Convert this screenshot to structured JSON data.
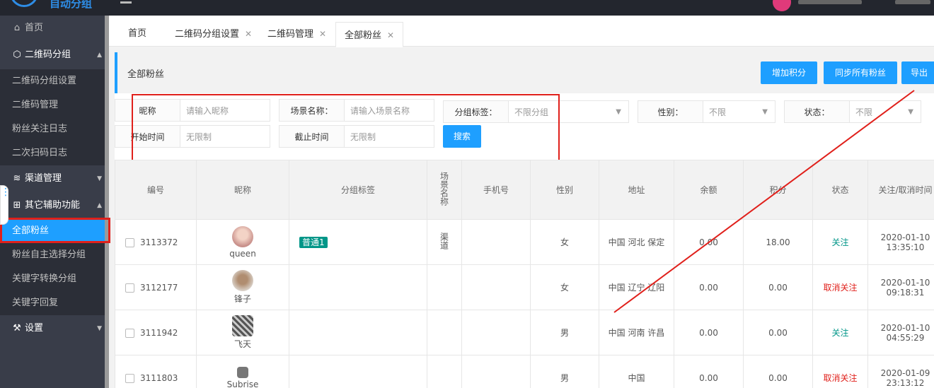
{
  "app": {
    "logo_text": "自动分组"
  },
  "sidebar": {
    "items": [
      {
        "label": "首页",
        "icon": "home-icon"
      },
      {
        "label": "二维码分组",
        "icon": "cube-icon"
      },
      {
        "label": "二维码分组设置"
      },
      {
        "label": "二维码管理"
      },
      {
        "label": "粉丝关注日志"
      },
      {
        "label": "二次扫码日志"
      },
      {
        "label": "渠道管理",
        "icon": "layers-icon"
      },
      {
        "label": "其它辅助功能",
        "icon": "apps-icon"
      },
      {
        "label": "全部粉丝"
      },
      {
        "label": "粉丝自主选择分组"
      },
      {
        "label": "关键字转换分组"
      },
      {
        "label": "关键字回复"
      },
      {
        "label": "设置",
        "icon": "wrench-icon"
      }
    ]
  },
  "tabs": [
    {
      "label": "首页",
      "closable": false
    },
    {
      "label": "二维码分组设置",
      "closable": true
    },
    {
      "label": "二维码管理",
      "closable": true
    },
    {
      "label": "全部粉丝",
      "closable": true,
      "active": true
    }
  ],
  "header": {
    "title": "全部粉丝",
    "buttons": {
      "add_points": "增加积分",
      "sync_fans": "同步所有粉丝",
      "export": "导出"
    }
  },
  "filters": {
    "nickname": {
      "label": "昵称",
      "placeholder": "请输入昵称"
    },
    "scene": {
      "label": "场景名称：",
      "placeholder": "请输入场景名称"
    },
    "group_tag": {
      "label": "分组标签：",
      "value": "不限分组"
    },
    "gender": {
      "label": "性别：",
      "value": "不限"
    },
    "status": {
      "label": "状态：",
      "value": "不限"
    },
    "start_time": {
      "label": "开始时间",
      "placeholder": "无限制"
    },
    "end_time": {
      "label": "截止时间",
      "placeholder": "无限制"
    },
    "search_label": "搜索"
  },
  "table": {
    "columns": [
      "编号",
      "昵称",
      "分组标签",
      "场景名称",
      "手机号",
      "性别",
      "地址",
      "余额",
      "积分",
      "状态",
      "关注/取消时间"
    ],
    "rows": [
      {
        "id": "3113372",
        "nickname": "queen",
        "tag": "普通1",
        "scene": "渠道",
        "phone": "",
        "gender": "女",
        "address": "中国 河北 保定",
        "balance": "0.00",
        "points": "18.00",
        "status": "关注",
        "date": "2020-01-10",
        "time": "13:35:10"
      },
      {
        "id": "3112177",
        "nickname": "锋子",
        "tag": "",
        "scene": "",
        "phone": "",
        "gender": "女",
        "address": "中国 辽宁 辽阳",
        "balance": "0.00",
        "points": "0.00",
        "status": "取消关注",
        "date": "2020-01-10",
        "time": "09:18:31"
      },
      {
        "id": "3111942",
        "nickname": "飞天",
        "tag": "",
        "scene": "",
        "phone": "",
        "gender": "男",
        "address": "中国 河南 许昌",
        "balance": "0.00",
        "points": "0.00",
        "status": "关注",
        "date": "2020-01-10",
        "time": "04:55:29"
      },
      {
        "id": "3111803",
        "nickname": "Subrise",
        "tag": "",
        "scene": "",
        "phone": "",
        "gender": "男",
        "address": "中国",
        "balance": "0.00",
        "points": "0.00",
        "status": "取消关注",
        "date": "2020-01-09",
        "time": "23:13:12"
      }
    ]
  },
  "colors": {
    "primary": "#1e9fff",
    "sidebar": "#393d49",
    "annotation": "#e0201b",
    "tag": "#009688"
  }
}
